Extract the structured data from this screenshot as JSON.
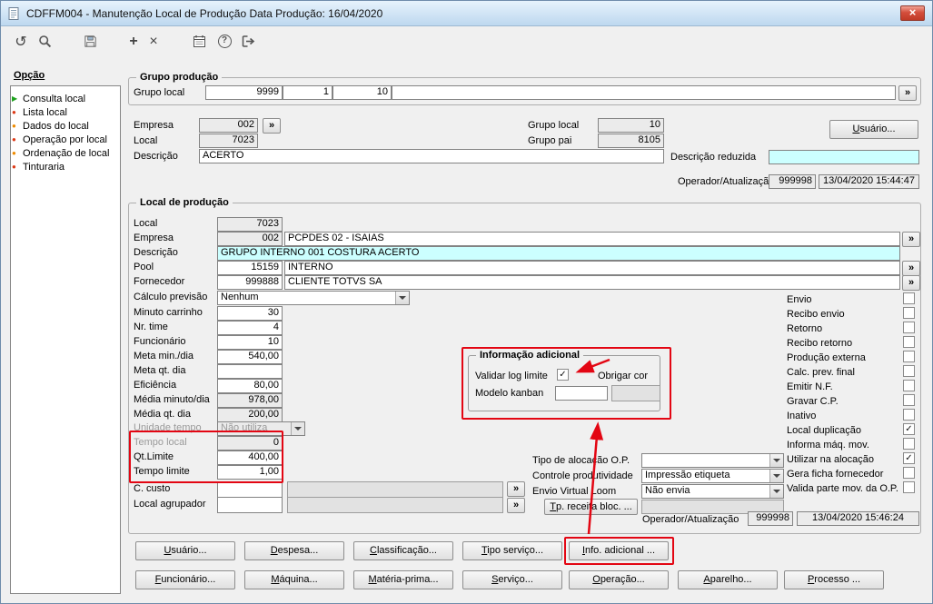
{
  "window": {
    "title": "CDFFM004 - Manutenção Local de Produção Data Produção: 16/04/2020"
  },
  "ui": {
    "lookup": "»",
    "annotation_color": "#e30613",
    "highlight_color": "#ccffff"
  },
  "toolbar": {
    "icons": [
      "undo",
      "search",
      "save",
      "add",
      "delete",
      "calendar",
      "help",
      "exit"
    ],
    "undo_glyph": "↺",
    "add_glyph": "+",
    "delete_glyph": "×",
    "help_glyph": "?"
  },
  "sidebar": {
    "title": "Opção",
    "items": [
      {
        "label": "Consulta local",
        "icon": "play-green"
      },
      {
        "label": "Lista local",
        "icon": "dot-red"
      },
      {
        "label": "Dados do local",
        "icon": "dot-orange"
      },
      {
        "label": "Operação por local",
        "icon": "dot-red"
      },
      {
        "label": "Ordenação de local",
        "icon": "dot-orange"
      },
      {
        "label": "Tinturaria",
        "icon": "dot-red"
      }
    ]
  },
  "grupo_producao": {
    "legend": "Grupo produção",
    "label": "Grupo local",
    "code1": "9999",
    "code2": "1",
    "code3": "10",
    "code4": ""
  },
  "header": {
    "empresa_label": "Empresa",
    "empresa": "002",
    "local_label": "Local",
    "local": "7023",
    "descricao_label": "Descrição",
    "descricao": "ACERTO",
    "grupo_local_label": "Grupo local",
    "grupo_local": "10",
    "grupo_pai_label": "Grupo pai",
    "grupo_pai": "8105",
    "usuario_button": "Usuário...",
    "descricao_reduzida_label": "Descrição reduzida",
    "descricao_reduzida": "",
    "operador_label": "Operador/Atualização",
    "operador_id": "999998",
    "operador_data": "13/04/2020 15:44:47"
  },
  "producao": {
    "legend": "Local de produção",
    "local_label": "Local",
    "local": "7023",
    "empresa_label": "Empresa",
    "empresa": "002",
    "empresa_desc": "PCPDES 02 - ISAIAS",
    "descricao_label": "Descrição",
    "descricao": "GRUPO INTERNO 001 COSTURA ACERTO",
    "pool_label": "Pool",
    "pool": "15159",
    "pool_desc": "INTERNO",
    "fornecedor_label": "Fornecedor",
    "fornecedor": "999888",
    "fornecedor_desc": "CLIENTE TOTVS SA",
    "calculo_previsao_label": "Cálculo previsão",
    "calculo_previsao": "Nenhum",
    "minuto_carrinho_label": "Minuto carrinho",
    "minuto_carrinho": "30",
    "nr_time_label": "Nr. time",
    "nr_time": "4",
    "funcionario_label": "Funcionário",
    "funcionario": "10",
    "meta_min_dia_label": "Meta min./dia",
    "meta_min_dia": "540,00",
    "meta_qt_dia_label": "Meta qt. dia",
    "meta_qt_dia": "",
    "eficiencia_label": "Eficiência",
    "eficiencia": "80,00",
    "media_minuto_label": "Média minuto/dia",
    "media_minuto": "978,00",
    "media_qt_label": "Média qt. dia",
    "media_qt": "200,00",
    "unidade_tempo_label": "Unidade tempo",
    "unidade_tempo": "Não utiliza",
    "tempo_local_label": "Tempo local",
    "tempo_local": "0",
    "qt_limite_label": "Qt.Limite",
    "qt_limite": "400,00",
    "tempo_limite_label": "Tempo limite",
    "tempo_limite": "1,00",
    "c_custo_label": "C. custo",
    "c_custo": "",
    "c_custo_desc": "",
    "local_agrupador_label": "Local agrupador",
    "local_agrupador": "",
    "local_agrupador_desc": ""
  },
  "info_adicional": {
    "legend": "Informação adicional",
    "validar_label": "Validar log limite",
    "validar_checked": true,
    "validar_mark": "✓",
    "modelo_label": "Modelo kanban",
    "modelo": "",
    "obrigar_label": "Obrigar cor"
  },
  "alocacao": {
    "tipo_label": "Tipo de alocação O.P.",
    "tipo": "",
    "controle_label": "Controle produtividade",
    "controle": "Impressão etiqueta",
    "envio_label": "Envio Virtual Loom",
    "envio": "Não envia",
    "tp_receita_button": "Tp. receita bloc. ...",
    "operador_label": "Operador/Atualização",
    "operador_id": "999998",
    "operador_data": "13/04/2020 15:46:24"
  },
  "flags": {
    "items": [
      {
        "label": "Envio",
        "checked": false,
        "mark": ""
      },
      {
        "label": "Recibo envio",
        "checked": false,
        "mark": ""
      },
      {
        "label": "Retorno",
        "checked": false,
        "mark": ""
      },
      {
        "label": "Recibo retorno",
        "checked": false,
        "mark": ""
      },
      {
        "label": "Produção externa",
        "checked": false,
        "mark": ""
      },
      {
        "label": "Calc. prev. final",
        "checked": false,
        "mark": ""
      },
      {
        "label": "Emitir N.F.",
        "checked": false,
        "mark": ""
      },
      {
        "label": "Gravar C.P.",
        "checked": false,
        "mark": ""
      },
      {
        "label": "Inativo",
        "checked": false,
        "mark": ""
      },
      {
        "label": "Local duplicação",
        "checked": true,
        "mark": "✓"
      },
      {
        "label": "Informa máq. mov.",
        "checked": false,
        "mark": ""
      },
      {
        "label": "Utilizar na alocação",
        "checked": true,
        "mark": "✓"
      },
      {
        "label": "Gera ficha fornecedor",
        "checked": false,
        "mark": ""
      },
      {
        "label": "Valida parte mov. da O.P.",
        "checked": false,
        "mark": ""
      }
    ]
  },
  "buttons": {
    "row1": [
      "Usuário...",
      "Despesa...",
      "Classificação...",
      "Tipo serviço...",
      "Info. adicional ..."
    ],
    "row2": [
      "Funcionário...",
      "Máquina...",
      "Matéria-prima...",
      "Serviço...",
      "Operação...",
      "Aparelho...",
      "Processo ..."
    ]
  }
}
